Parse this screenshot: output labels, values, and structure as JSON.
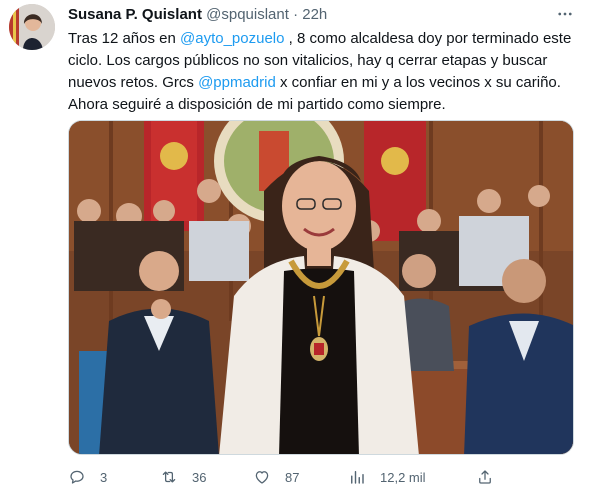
{
  "tweet": {
    "author_name": "Susana P. Quislant",
    "handle": "@spquislant",
    "separator": "·",
    "time": "22h",
    "text_parts": [
      {
        "text": "Tras 12 años en ",
        "kind": "plain"
      },
      {
        "text": "@ayto_pozuelo",
        "kind": "mention"
      },
      {
        "text": " , 8 como alcaldesa  doy por terminado este ciclo. Los cargos públicos no son vitalicios, hay q cerrar etapas y buscar nuevos retos. Grcs ",
        "kind": "plain"
      },
      {
        "text": "@ppmadrid",
        "kind": "mention"
      },
      {
        "text": " x confiar en mi y a los vecinos x su cariño. Ahora seguiré a disposición de mi partido como siempre.",
        "kind": "plain"
      }
    ]
  },
  "actions": {
    "replies": "3",
    "retweets": "36",
    "likes": "87",
    "views": "12,2 mil"
  },
  "icons": {
    "more": "more-horizontal-icon",
    "reply": "reply-icon",
    "retweet": "retweet-icon",
    "like": "heart-icon",
    "views": "views-bar-chart-icon",
    "share": "share-icon"
  },
  "colors": {
    "link": "#1d9bf0",
    "text": "#0f1419",
    "muted": "#536471"
  }
}
